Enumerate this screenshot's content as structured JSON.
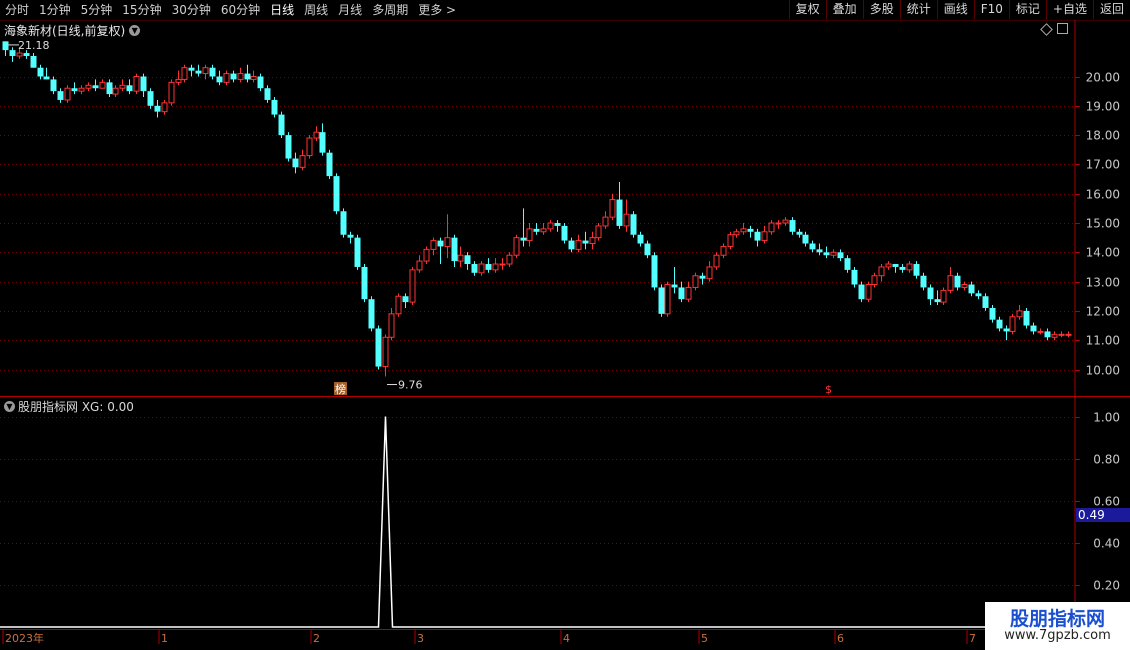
{
  "toolbar": {
    "periods": [
      "分时",
      "1分钟",
      "5分钟",
      "15分钟",
      "30分钟",
      "60分钟",
      "日线",
      "周线",
      "月线",
      "多周期",
      "更多 >"
    ],
    "active_period": "日线",
    "buttons": [
      "复权",
      "叠加",
      "多股",
      "统计",
      "画线",
      "F10",
      "标记",
      "+自选",
      "返回"
    ]
  },
  "chart_header": {
    "title": "海象新材(日线,前复权)"
  },
  "indicator_header": {
    "title": "股朋指标网 XG: 0.00"
  },
  "watermark": {
    "line1": "股朋指标网",
    "line2": "www.7gpzb.com"
  },
  "colors": {
    "background": "#000000",
    "up": "#ff3232",
    "down": "#54ffff",
    "grid": "#7a0000",
    "axis": "#b00000",
    "indicator_line": "#ffffff",
    "value_tag_bg": "#1a1a9a"
  },
  "chart_data": [
    {
      "type": "candlestick",
      "title": "海象新材(日线,前复权)",
      "y_ticks": [
        10.0,
        11.0,
        12.0,
        13.0,
        14.0,
        15.0,
        16.0,
        17.0,
        18.0,
        19.0,
        20.0
      ],
      "ylim": [
        9.6,
        21.5
      ],
      "annotations": {
        "high": "21.18",
        "low": "9.76",
        "markers": [
          "榜",
          "$"
        ]
      },
      "x_labels": [
        "2023年",
        "1",
        "2",
        "3",
        "4",
        "5",
        "6",
        "7"
      ],
      "ohlc": [
        [
          21.2,
          20.9,
          21.2,
          20.7
        ],
        [
          20.9,
          20.7,
          21.0,
          20.5
        ],
        [
          20.7,
          20.8,
          21.0,
          20.6
        ],
        [
          20.8,
          20.7,
          20.9,
          20.6
        ],
        [
          20.7,
          20.3,
          20.8,
          20.3
        ],
        [
          20.3,
          20.0,
          20.4,
          19.9
        ],
        [
          20.0,
          19.9,
          20.3,
          19.9
        ],
        [
          19.9,
          19.5,
          20.0,
          19.4
        ],
        [
          19.5,
          19.2,
          19.6,
          19.1
        ],
        [
          19.2,
          19.6,
          19.7,
          19.1
        ],
        [
          19.6,
          19.5,
          19.8,
          19.4
        ],
        [
          19.5,
          19.6,
          19.7,
          19.4
        ],
        [
          19.6,
          19.7,
          19.8,
          19.5
        ],
        [
          19.7,
          19.6,
          19.9,
          19.5
        ],
        [
          19.6,
          19.8,
          19.9,
          19.6
        ],
        [
          19.8,
          19.4,
          19.9,
          19.3
        ],
        [
          19.4,
          19.6,
          19.7,
          19.3
        ],
        [
          19.6,
          19.7,
          19.9,
          19.5
        ],
        [
          19.7,
          19.5,
          19.9,
          19.4
        ],
        [
          19.5,
          20.0,
          20.1,
          19.4
        ],
        [
          20.0,
          19.5,
          20.1,
          19.3
        ],
        [
          19.5,
          19.0,
          19.6,
          18.9
        ],
        [
          19.0,
          18.8,
          19.2,
          18.6
        ],
        [
          18.8,
          19.1,
          19.2,
          18.7
        ],
        [
          19.1,
          19.8,
          19.9,
          19.0
        ],
        [
          19.8,
          19.9,
          20.2,
          19.7
        ],
        [
          19.9,
          20.3,
          20.4,
          19.8
        ],
        [
          20.3,
          20.2,
          20.4,
          20.0
        ],
        [
          20.2,
          20.1,
          20.4,
          20.0
        ],
        [
          20.1,
          20.3,
          20.4,
          19.9
        ],
        [
          20.3,
          20.0,
          20.4,
          19.9
        ],
        [
          20.0,
          19.8,
          20.2,
          19.7
        ],
        [
          19.8,
          20.1,
          20.2,
          19.7
        ],
        [
          20.1,
          19.9,
          20.2,
          19.8
        ],
        [
          19.9,
          20.1,
          20.3,
          19.8
        ],
        [
          20.1,
          19.9,
          20.4,
          19.8
        ],
        [
          19.9,
          20.0,
          20.2,
          19.8
        ],
        [
          20.0,
          19.6,
          20.1,
          19.5
        ],
        [
          19.6,
          19.2,
          19.7,
          19.1
        ],
        [
          19.2,
          18.7,
          19.3,
          18.6
        ],
        [
          18.7,
          18.0,
          18.8,
          17.9
        ],
        [
          18.0,
          17.2,
          18.1,
          17.1
        ],
        [
          17.2,
          16.9,
          17.4,
          16.7
        ],
        [
          16.9,
          17.3,
          17.5,
          16.8
        ],
        [
          17.3,
          17.9,
          18.0,
          17.2
        ],
        [
          17.9,
          18.1,
          18.3,
          17.8
        ],
        [
          18.1,
          17.4,
          18.4,
          17.3
        ],
        [
          17.4,
          16.6,
          17.5,
          16.5
        ],
        [
          16.6,
          15.4,
          16.7,
          15.3
        ],
        [
          15.4,
          14.6,
          15.5,
          14.5
        ],
        [
          14.6,
          14.5,
          14.7,
          14.3
        ],
        [
          14.5,
          13.5,
          14.6,
          13.4
        ],
        [
          13.5,
          12.4,
          13.6,
          12.3
        ],
        [
          12.4,
          11.4,
          12.5,
          11.3
        ],
        [
          11.4,
          10.1,
          11.5,
          10.0
        ],
        [
          10.1,
          11.1,
          11.2,
          9.76
        ],
        [
          11.1,
          11.9,
          12.1,
          11.0
        ],
        [
          11.9,
          12.5,
          12.6,
          11.8
        ],
        [
          12.5,
          12.3,
          12.6,
          12.1
        ],
        [
          12.3,
          13.4,
          13.5,
          12.2
        ],
        [
          13.4,
          13.7,
          13.9,
          13.3
        ],
        [
          13.7,
          14.1,
          14.2,
          13.6
        ],
        [
          14.1,
          14.4,
          14.5,
          13.9
        ],
        [
          14.4,
          14.2,
          14.5,
          13.6
        ],
        [
          14.2,
          14.5,
          15.3,
          13.8
        ],
        [
          14.5,
          13.7,
          14.6,
          13.5
        ],
        [
          13.7,
          13.9,
          14.2,
          13.5
        ],
        [
          13.9,
          13.6,
          14.0,
          13.4
        ],
        [
          13.6,
          13.3,
          13.7,
          13.2
        ],
        [
          13.3,
          13.6,
          13.7,
          13.2
        ],
        [
          13.6,
          13.4,
          13.8,
          13.3
        ],
        [
          13.4,
          13.6,
          13.8,
          13.3
        ],
        [
          13.6,
          13.6,
          13.8,
          13.4
        ],
        [
          13.6,
          13.9,
          14.0,
          13.5
        ],
        [
          13.9,
          14.5,
          14.6,
          13.8
        ],
        [
          14.5,
          14.4,
          15.5,
          14.2
        ],
        [
          14.4,
          14.8,
          15.0,
          14.2
        ],
        [
          14.8,
          14.7,
          15.0,
          14.6
        ],
        [
          14.7,
          14.8,
          15.0,
          14.6
        ],
        [
          14.8,
          15.0,
          15.1,
          14.7
        ],
        [
          15.0,
          14.9,
          15.1,
          14.7
        ],
        [
          14.9,
          14.4,
          15.0,
          14.3
        ],
        [
          14.4,
          14.1,
          14.5,
          14.0
        ],
        [
          14.1,
          14.4,
          14.6,
          14.0
        ],
        [
          14.4,
          14.3,
          14.7,
          14.1
        ],
        [
          14.3,
          14.5,
          14.7,
          14.1
        ],
        [
          14.5,
          14.9,
          15.0,
          14.4
        ],
        [
          14.9,
          15.2,
          15.4,
          14.8
        ],
        [
          15.2,
          15.8,
          16.0,
          15.1
        ],
        [
          15.8,
          14.9,
          16.4,
          14.8
        ],
        [
          14.9,
          15.3,
          15.8,
          14.7
        ],
        [
          15.3,
          14.6,
          15.4,
          14.5
        ],
        [
          14.6,
          14.3,
          14.7,
          14.2
        ],
        [
          14.3,
          13.9,
          14.4,
          13.8
        ],
        [
          13.9,
          12.8,
          14.0,
          12.7
        ],
        [
          12.8,
          11.9,
          12.9,
          11.8
        ],
        [
          11.9,
          12.9,
          13.0,
          11.8
        ],
        [
          12.9,
          12.8,
          13.5,
          12.6
        ],
        [
          12.8,
          12.4,
          13.0,
          12.3
        ],
        [
          12.4,
          12.8,
          13.0,
          12.3
        ],
        [
          12.8,
          13.2,
          13.3,
          12.7
        ],
        [
          13.2,
          13.1,
          13.3,
          12.9
        ],
        [
          13.1,
          13.5,
          13.7,
          13.0
        ],
        [
          13.5,
          13.9,
          14.0,
          13.4
        ],
        [
          13.9,
          14.2,
          14.3,
          13.8
        ],
        [
          14.2,
          14.6,
          14.7,
          14.1
        ],
        [
          14.6,
          14.7,
          14.8,
          14.5
        ],
        [
          14.7,
          14.8,
          15.0,
          14.6
        ],
        [
          14.8,
          14.7,
          14.9,
          14.5
        ],
        [
          14.7,
          14.4,
          14.8,
          14.2
        ],
        [
          14.4,
          14.7,
          14.9,
          14.3
        ],
        [
          14.7,
          15.0,
          15.1,
          14.6
        ],
        [
          15.0,
          15.0,
          15.1,
          14.8
        ],
        [
          15.0,
          15.1,
          15.2,
          14.9
        ],
        [
          15.1,
          14.7,
          15.2,
          14.6
        ],
        [
          14.7,
          14.6,
          14.8,
          14.5
        ],
        [
          14.6,
          14.3,
          14.7,
          14.2
        ],
        [
          14.3,
          14.1,
          14.4,
          14.0
        ],
        [
          14.1,
          14.0,
          14.3,
          13.9
        ],
        [
          14.0,
          13.9,
          14.2,
          13.8
        ],
        [
          13.9,
          14.0,
          14.1,
          13.8
        ],
        [
          14.0,
          13.8,
          14.1,
          13.7
        ],
        [
          13.8,
          13.4,
          13.9,
          13.3
        ],
        [
          13.4,
          12.9,
          13.5,
          12.8
        ],
        [
          12.9,
          12.4,
          13.0,
          12.3
        ],
        [
          12.4,
          12.9,
          13.0,
          12.3
        ],
        [
          12.9,
          13.2,
          13.3,
          12.8
        ],
        [
          13.2,
          13.5,
          13.6,
          13.0
        ],
        [
          13.5,
          13.6,
          13.7,
          13.4
        ],
        [
          13.6,
          13.5,
          13.6,
          13.3
        ],
        [
          13.5,
          13.4,
          13.6,
          13.3
        ],
        [
          13.4,
          13.6,
          13.7,
          13.3
        ],
        [
          13.6,
          13.2,
          13.7,
          13.1
        ],
        [
          13.2,
          12.8,
          13.3,
          12.7
        ],
        [
          12.8,
          12.4,
          12.9,
          12.2
        ],
        [
          12.4,
          12.3,
          12.7,
          12.2
        ],
        [
          12.3,
          12.7,
          12.8,
          12.2
        ],
        [
          12.7,
          13.2,
          13.5,
          12.6
        ],
        [
          13.2,
          12.8,
          13.3,
          12.7
        ],
        [
          12.8,
          12.9,
          13.0,
          12.7
        ],
        [
          12.9,
          12.6,
          13.0,
          12.5
        ],
        [
          12.6,
          12.5,
          12.7,
          12.4
        ],
        [
          12.5,
          12.1,
          12.6,
          12.0
        ],
        [
          12.1,
          11.7,
          12.2,
          11.6
        ],
        [
          11.7,
          11.4,
          11.8,
          11.3
        ],
        [
          11.4,
          11.3,
          11.5,
          11.0
        ],
        [
          11.3,
          11.8,
          11.9,
          11.2
        ],
        [
          11.8,
          12.0,
          12.2,
          11.7
        ],
        [
          12.0,
          11.5,
          12.1,
          11.4
        ],
        [
          11.5,
          11.3,
          11.6,
          11.2
        ],
        [
          11.3,
          11.3,
          11.4,
          11.2
        ],
        [
          11.3,
          11.1,
          11.4,
          11.0
        ],
        [
          11.1,
          11.2,
          11.3,
          11.0
        ],
        [
          11.2,
          11.2,
          11.3,
          11.1
        ],
        [
          11.2,
          11.2,
          11.3,
          11.1
        ]
      ]
    },
    {
      "type": "line",
      "title": "股朋指标网 XG: 0.00",
      "y_ticks": [
        0.2,
        0.4,
        0.6,
        0.8,
        1.0
      ],
      "current_value_tag": "0.49",
      "series": [
        {
          "signal_day_index": 55,
          "values": "0 everywhere except 1.00 at the signal day"
        }
      ]
    }
  ]
}
